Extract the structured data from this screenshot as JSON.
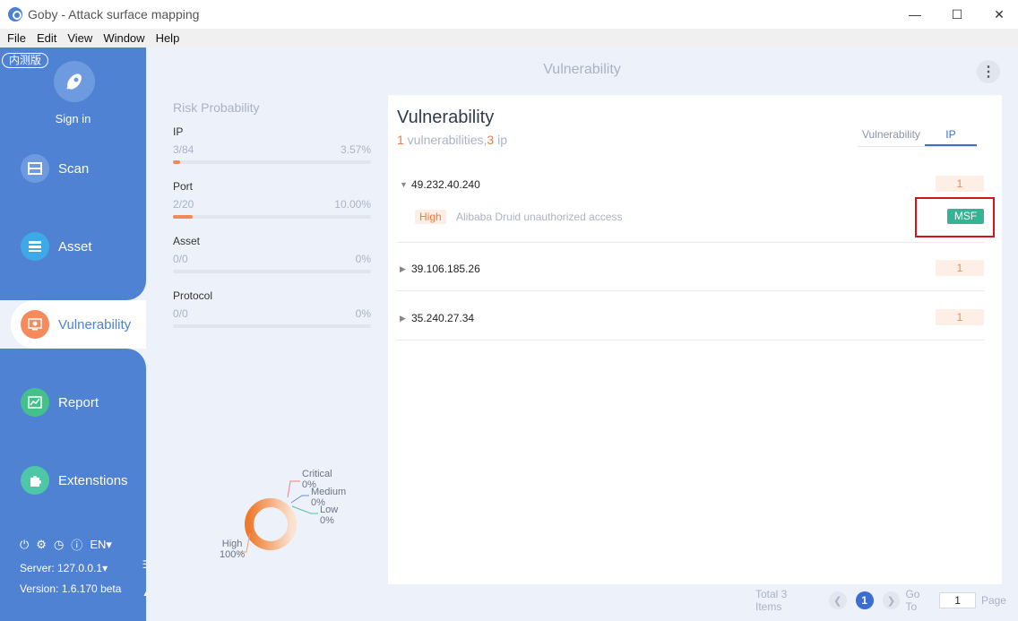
{
  "window": {
    "title": "Goby - Attack surface mapping",
    "minimize": "—",
    "maximize": "☐",
    "close": "✕"
  },
  "menu": [
    "File",
    "Edit",
    "View",
    "Window",
    "Help"
  ],
  "sidebar": {
    "beta_tag": "内测版",
    "sign_in": "Sign in",
    "nav": [
      {
        "label": "Scan",
        "icon": "scan-icon",
        "color": "#6e9be0"
      },
      {
        "label": "Asset",
        "icon": "asset-icon",
        "color": "#3fa9e8"
      },
      {
        "label": "Vulnerability",
        "icon": "vulnerability-icon",
        "color": "#f58a5c"
      },
      {
        "label": "Report",
        "icon": "report-icon",
        "color": "#44c08a"
      },
      {
        "label": "Extenstions",
        "icon": "extensions-icon",
        "color": "#4ec7a6"
      }
    ],
    "language": "EN",
    "server": "Server: 127.0.0.1",
    "version": "Version: 1.6.170 beta"
  },
  "main": {
    "title": "Vulnerability",
    "risk": {
      "heading": "Risk Probability",
      "rows": [
        {
          "name": "IP",
          "count": "3/84",
          "percent": "3.57%",
          "fraction": 0.0357
        },
        {
          "name": "Port",
          "count": "2/20",
          "percent": "10.00%",
          "fraction": 0.1
        },
        {
          "name": "Asset",
          "count": "0/0",
          "percent": "0%",
          "fraction": 0
        },
        {
          "name": "Protocol",
          "count": "0/0",
          "percent": "0%",
          "fraction": 0
        }
      ]
    },
    "severity_chart": [
      {
        "label": "Critical",
        "percent": "0%"
      },
      {
        "label": "Medium",
        "percent": "0%"
      },
      {
        "label": "Low",
        "percent": "0%"
      },
      {
        "label": "High",
        "percent": "100%"
      }
    ],
    "panel": {
      "title": "Vulnerability",
      "vuln_count": "1",
      "vuln_text": " vulnerabilities,",
      "ip_count": "3",
      "ip_text": " ip",
      "tabs": [
        "Vulnerability",
        "IP"
      ],
      "active_tab": "IP",
      "ips": [
        {
          "address": "49.232.40.240",
          "count": "1",
          "expanded": true,
          "vulns": [
            {
              "severity": "High",
              "name": "Alibaba Druid unauthorized access",
              "tag": "MSF"
            }
          ]
        },
        {
          "address": "39.106.185.26",
          "count": "1",
          "expanded": false
        },
        {
          "address": "35.240.27.34",
          "count": "1",
          "expanded": false
        }
      ]
    },
    "pagination": {
      "total": "Total 3 Items",
      "current": "1",
      "goto_label": "Go To",
      "goto_value": "1",
      "page_label": "Page"
    }
  }
}
